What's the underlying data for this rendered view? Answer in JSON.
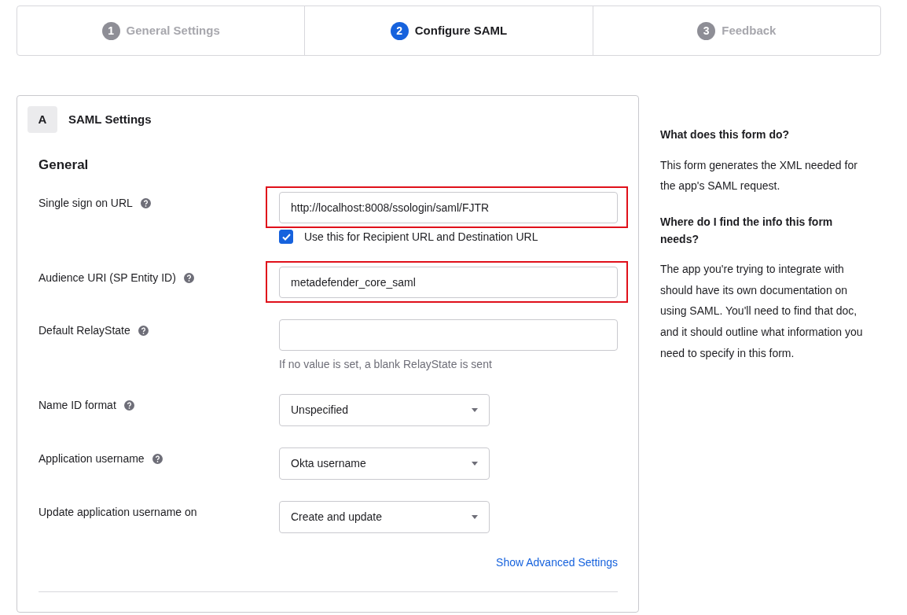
{
  "steps": [
    {
      "number": "1",
      "label": "General Settings",
      "selected": false
    },
    {
      "number": "2",
      "label": "Configure SAML",
      "selected": true
    },
    {
      "number": "3",
      "label": "Feedback",
      "selected": false
    }
  ],
  "section": {
    "letter": "A",
    "title": "SAML Settings",
    "group": "General",
    "fields": [
      {
        "kind": "text",
        "label": "Single sign on URL",
        "help": true,
        "value": "http://localhost:8008/ssologin/saml/FJTR",
        "highlighted": true,
        "checkbox": {
          "label": "Use this for Recipient URL and Destination URL",
          "checked": true
        }
      },
      {
        "kind": "text",
        "label": "Audience URI (SP Entity ID)",
        "help": true,
        "value": "metadefender_core_saml",
        "highlighted": true
      },
      {
        "kind": "text",
        "label": "Default RelayState",
        "help": true,
        "highlighted": false,
        "note": "If no value is set, a blank RelayState is sent"
      },
      {
        "kind": "select",
        "label": "Name ID format",
        "help": true,
        "value": "Unspecified",
        "highlighted": false
      },
      {
        "kind": "select",
        "label": "Application username",
        "help": true,
        "value": "Okta username",
        "highlighted": false
      },
      {
        "kind": "select",
        "label": "Update application username on",
        "help": false,
        "value": "Create and update",
        "highlighted": false
      }
    ],
    "advanced_link": "Show Advanced Settings"
  },
  "help_panel": [
    {
      "question": "What does this form do?",
      "answer": "This form generates the XML needed for the app's SAML request."
    },
    {
      "question": "Where do I find the info this form needs?",
      "answer": "The app you're trying to integrate with should have its own documentation on using SAML. You'll need to find that doc, and it should outline what information you need to specify in this form."
    }
  ]
}
